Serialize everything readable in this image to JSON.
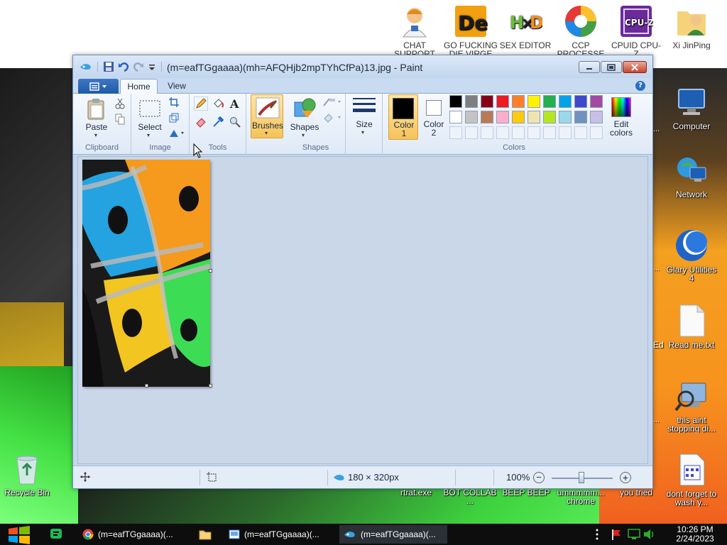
{
  "desktop": {
    "top_icons": [
      {
        "label": "CHAT SUPPORT",
        "icon": "support-person-icon"
      },
      {
        "label": "GO FUCKING DIE VIRGE",
        "icon": "de-icon"
      },
      {
        "label": "SEX EDITOR",
        "icon": "hxd-icon"
      },
      {
        "label": "CCP PROCESSE",
        "icon": "process-icon"
      },
      {
        "label": "CPUID CPU-Z",
        "icon": "cpuz-icon"
      },
      {
        "label": "Xi JinPing",
        "icon": "user-folder-icon"
      }
    ],
    "right_icons": [
      {
        "label": "Computer",
        "icon": "computer-icon"
      },
      {
        "label": "Network",
        "icon": "network-icon"
      },
      {
        "label": "Glary Utilities 4",
        "icon": "glary-icon"
      },
      {
        "label": "Read me.txt",
        "icon": "text-file-icon"
      },
      {
        "label": "this aint stopping di...",
        "icon": "search-computer-icon"
      },
      {
        "label": "dont forget to wash y...",
        "icon": "calendar-file-icon"
      }
    ],
    "bottom_labels": [
      {
        "label": "rtrat.exe"
      },
      {
        "label": "BOT COLLAB ..."
      },
      {
        "label": "BEEP BEEP"
      },
      {
        "label": "ummmmm... chrome"
      },
      {
        "label": "you tried"
      }
    ],
    "recycle_bin": {
      "label": "Recycle Bin",
      "icon": "recycle-bin-icon"
    },
    "partial_labels": [
      "...",
      "...",
      "Ed",
      "..."
    ]
  },
  "paint": {
    "title": "(m=eafTGgaaaa)(mh=AFQHjb2mpTYhCfPa)13.jpg - Paint",
    "tabs": {
      "home": "Home",
      "view": "View"
    },
    "groups": {
      "clipboard": "Clipboard",
      "image": "Image",
      "tools": "Tools",
      "shapes": "Shapes",
      "colors": "Colors"
    },
    "buttons": {
      "paste": "Paste",
      "select": "Select",
      "brushes": "Brushes",
      "shapes": "Shapes",
      "size": "Size",
      "color1_a": "Color",
      "color1_b": "1",
      "color2_a": "Color",
      "color2_b": "2",
      "edit_colors_a": "Edit",
      "edit_colors_b": "colors"
    },
    "palette_row1": [
      "#000000",
      "#7f7f7f",
      "#880015",
      "#ed1c24",
      "#ff7f27",
      "#fff200",
      "#22b14c",
      "#00a2e8",
      "#3f48cc",
      "#a349a4"
    ],
    "palette_row2": [
      "#ffffff",
      "#c3c3c3",
      "#b97a57",
      "#ffaec9",
      "#ffc90e",
      "#efe4b0",
      "#b5e61d",
      "#99d9ea",
      "#7092be",
      "#c8bfe7"
    ],
    "color1": "#000000",
    "color2": "#ffffff",
    "status": {
      "image_size": "180 × 320px",
      "zoom": "100%"
    }
  },
  "taskbar": {
    "items": [
      {
        "label": "(m=eafTGgaaaa)(...",
        "icon": "chrome-icon"
      },
      {
        "label": "",
        "icon": "folder-icon"
      },
      {
        "label": "(m=eafTGgaaaa)(...",
        "icon": "photo-viewer-icon"
      },
      {
        "label": "(m=eafTGgaaaa)(...",
        "icon": "paint-icon"
      }
    ],
    "time": "10:26 PM",
    "date": "2/24/2023"
  }
}
